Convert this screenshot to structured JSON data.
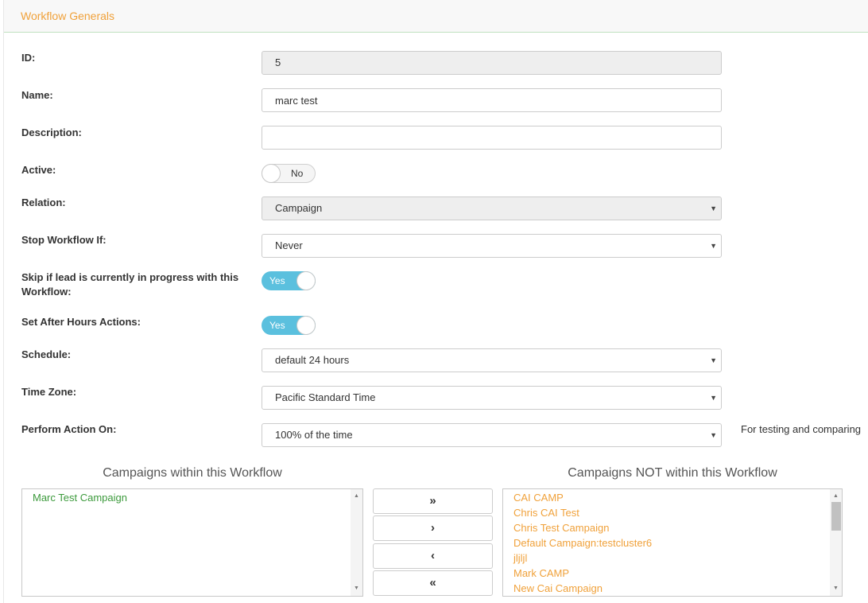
{
  "header": {
    "title": "Workflow Generals"
  },
  "fields": {
    "id": {
      "label": "ID:",
      "value": "5"
    },
    "name": {
      "label": "Name:",
      "value": "marc test"
    },
    "description": {
      "label": "Description:",
      "value": ""
    },
    "active": {
      "label": "Active:",
      "state": "No"
    },
    "relation": {
      "label": "Relation:",
      "value": "Campaign"
    },
    "stop_if": {
      "label": "Stop Workflow If:",
      "value": "Never"
    },
    "skip_in_progress": {
      "label": "Skip if lead is currently in progress with this Workflow:",
      "state": "Yes"
    },
    "after_hours": {
      "label": "Set After Hours Actions:",
      "state": "Yes"
    },
    "schedule": {
      "label": "Schedule:",
      "value": "default 24 hours"
    },
    "timezone": {
      "label": "Time Zone:",
      "value": "Pacific Standard Time"
    },
    "perform_on": {
      "label": "Perform Action On:",
      "value": "100% of the time",
      "note": "For testing and comparing"
    }
  },
  "lists": {
    "within": {
      "title": "Campaigns within this Workflow",
      "items": [
        "Marc Test Campaign"
      ],
      "color": "#3c9a3c"
    },
    "not_within": {
      "title": "Campaigns NOT within this Workflow",
      "items": [
        "CAI CAMP",
        "Chris CAI Test",
        "Chris Test Campaign",
        "Default Campaign:testcluster6",
        "jljljl",
        "Mark CAMP",
        "New Cai Campaign"
      ],
      "color": "#f0a13a"
    }
  },
  "move_buttons": {
    "add_all": "»",
    "add_one": "›",
    "remove_one": "‹",
    "remove_all": "«"
  },
  "icons": {
    "dropdown": "caret-down-icon",
    "scroll_up": "scroll-up-icon",
    "scroll_down": "scroll-down-icon"
  },
  "colors": {
    "accent": "#f0a13a",
    "toggle_on": "#5bc0de"
  }
}
